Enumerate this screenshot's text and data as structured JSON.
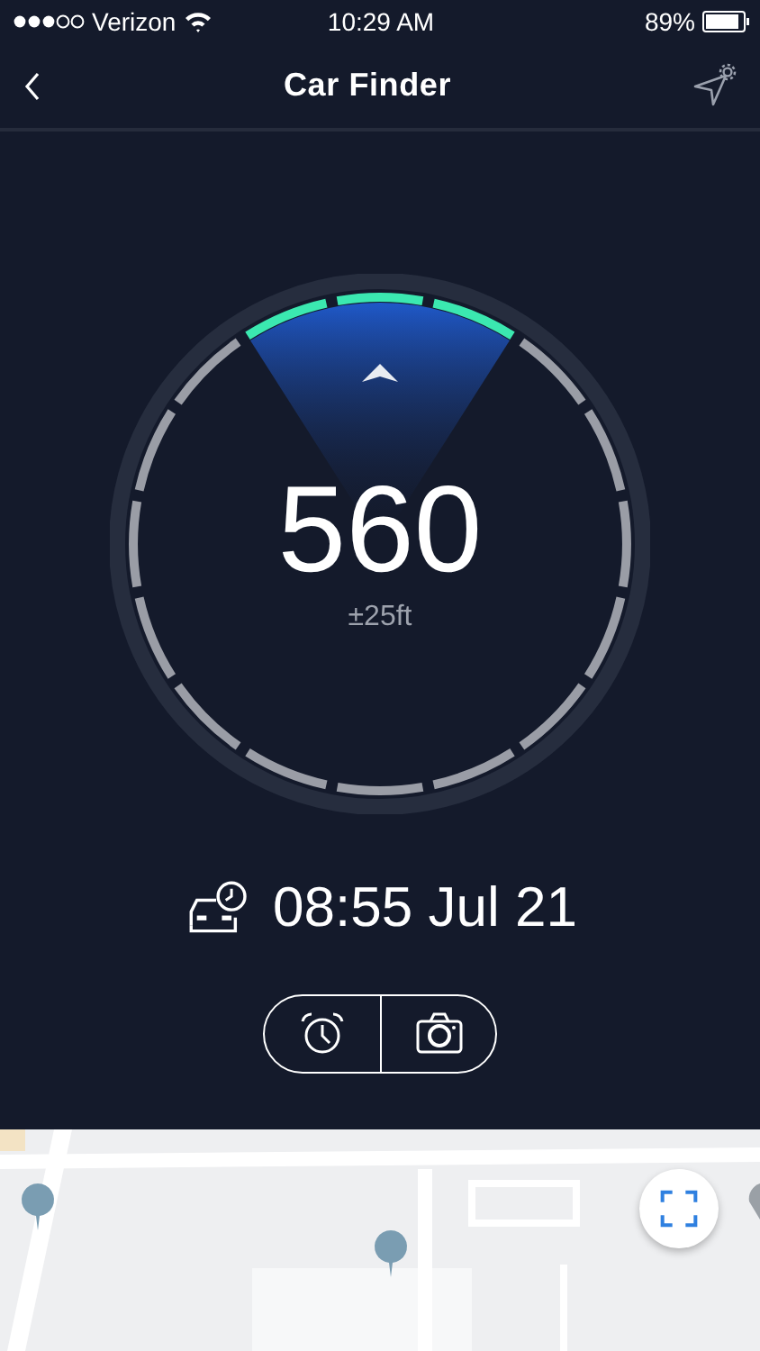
{
  "status_bar": {
    "carrier": "Verizon",
    "time": "10:29 AM",
    "battery": "89%"
  },
  "nav": {
    "title": "Car Finder"
  },
  "gauge": {
    "distance": "560",
    "accuracy": "±25ft"
  },
  "parked": {
    "time": "08:55 Jul 21"
  },
  "actions": [
    {
      "kind": "alarm"
    },
    {
      "kind": "camera"
    }
  ]
}
